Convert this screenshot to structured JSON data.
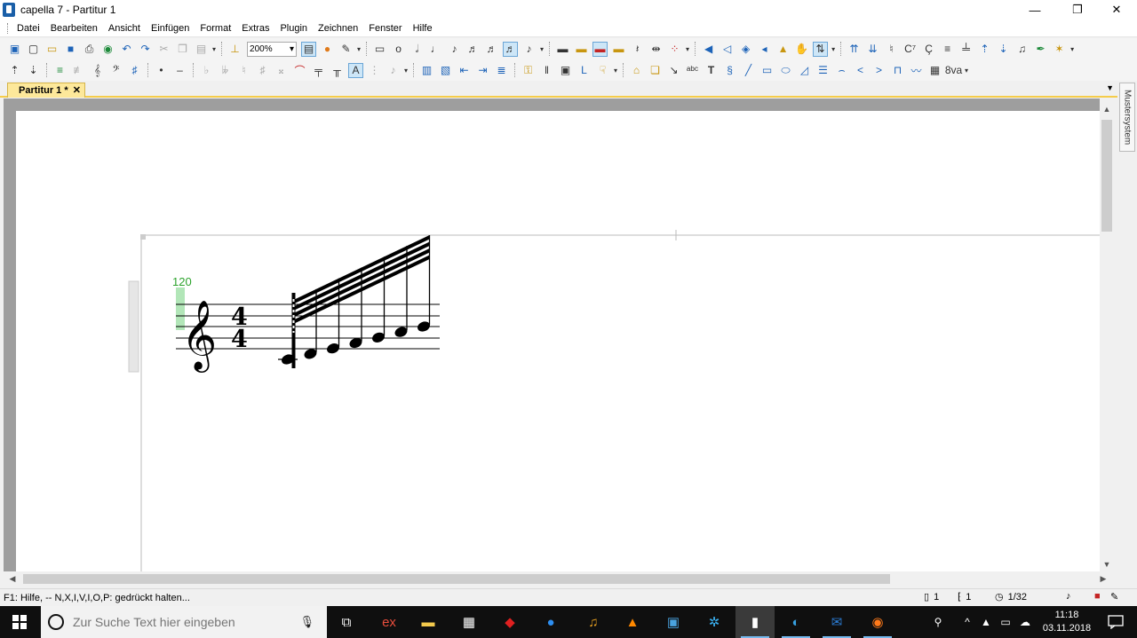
{
  "window": {
    "title": "capella 7 - Partitur 1",
    "controls": {
      "minimize": "—",
      "restore": "❐",
      "close": "✕"
    }
  },
  "menu": [
    "Datei",
    "Bearbeiten",
    "Ansicht",
    "Einfügen",
    "Format",
    "Extras",
    "Plugin",
    "Zeichnen",
    "Fenster",
    "Hilfe"
  ],
  "toolbar": {
    "zoom_value": "200%"
  },
  "tabs": {
    "active": "Partitur 1 *",
    "close": "✕",
    "dropdown": "▼"
  },
  "side_panel": {
    "tab_label": "Mustersystem"
  },
  "score": {
    "tempo": "120",
    "time_signature_top": "4",
    "time_signature_bottom": "4",
    "clef": "treble",
    "note_count": 7,
    "beams": 4
  },
  "statusbar": {
    "help_text": "F1: Hilfe, -- N,X,I,V,I,O,P: gedrückt halten...",
    "page": "1",
    "system": "1",
    "time": "1/32"
  },
  "taskbar": {
    "search_placeholder": "Zur Suche Text hier eingeben",
    "time": "11:18",
    "date": "03.11.2018"
  }
}
